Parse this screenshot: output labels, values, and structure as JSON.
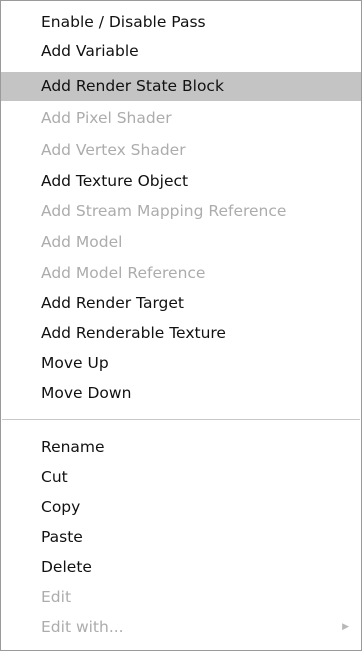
{
  "menu": {
    "items": [
      {
        "label": "Enable / Disable Pass",
        "enabled": true
      },
      {
        "label": "Add Variable",
        "enabled": true
      },
      {
        "label": "Add Render State Block",
        "enabled": true,
        "highlighted": true
      },
      {
        "label": "Add Pixel Shader",
        "enabled": false
      },
      {
        "label": "Add Vertex Shader",
        "enabled": false
      },
      {
        "label": "Add Texture Object",
        "enabled": true
      },
      {
        "label": "Add Stream Mapping Reference",
        "enabled": false
      },
      {
        "label": "Add Model",
        "enabled": false
      },
      {
        "label": "Add Model Reference",
        "enabled": false
      },
      {
        "label": "Add Render Target",
        "enabled": true
      },
      {
        "label": "Add Renderable Texture",
        "enabled": true
      },
      {
        "label": "Move Up",
        "enabled": true
      },
      {
        "label": "Move Down",
        "enabled": true
      },
      {
        "label": "Rename",
        "enabled": true
      },
      {
        "label": "Cut",
        "enabled": true
      },
      {
        "label": "Copy",
        "enabled": true
      },
      {
        "label": "Paste",
        "enabled": true
      },
      {
        "label": "Delete",
        "enabled": true
      },
      {
        "label": "Edit",
        "enabled": false
      },
      {
        "label": "Edit with...",
        "enabled": false,
        "submenu": true,
        "submenu_icon": "submenu-arrow-icon"
      }
    ]
  },
  "colors": {
    "highlight": "#c4c4c4",
    "disabled_text": "#acacac",
    "text": "#111111",
    "border": "#9a9a9a"
  }
}
